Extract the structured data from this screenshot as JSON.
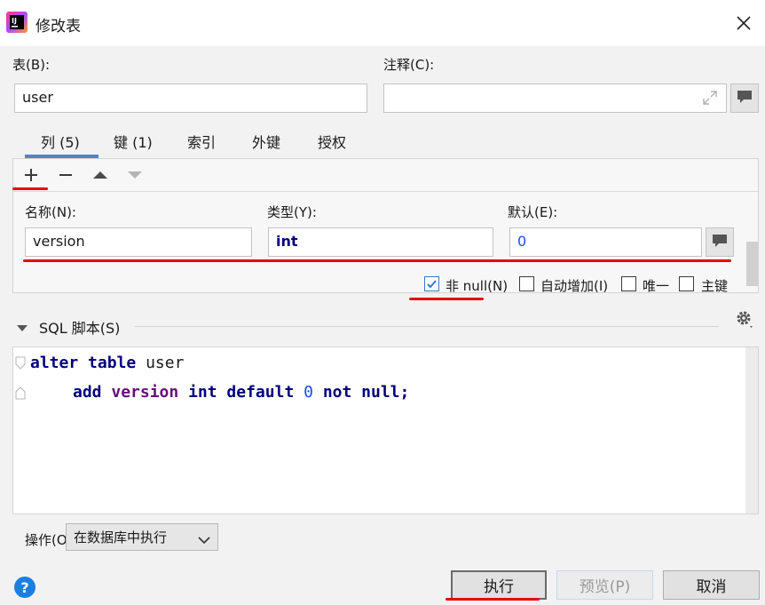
{
  "window": {
    "title": "修改表",
    "app_icon": "intellij-icon"
  },
  "table_field": {
    "label": "表(B):",
    "value": "user"
  },
  "comment_field": {
    "label": "注释(C):",
    "value": ""
  },
  "tabs": [
    {
      "label": "列 (5)",
      "active": true
    },
    {
      "label": "键 (1)",
      "active": false
    },
    {
      "label": "索引",
      "active": false
    },
    {
      "label": "外键",
      "active": false
    },
    {
      "label": "授权",
      "active": false
    }
  ],
  "column_toolbar": {
    "icons": [
      "add-icon",
      "remove-icon",
      "move-up-icon",
      "move-down-icon"
    ]
  },
  "column": {
    "name_label": "名称(N):",
    "name_value": "version",
    "type_label": "类型(Y):",
    "type_value": "int",
    "default_label": "默认(E):",
    "default_value": "0"
  },
  "options": [
    {
      "label": "非 null(N)",
      "checked": true
    },
    {
      "label": "自动增加(I)",
      "checked": false
    },
    {
      "label": "唯一",
      "checked": false
    },
    {
      "label": "主键",
      "checked": false
    }
  ],
  "sql_section": {
    "label": "SQL 脚本(S)"
  },
  "sql": {
    "line1": [
      "alter",
      "table",
      "user"
    ],
    "line2": [
      "add",
      "version",
      "int",
      "default",
      "0",
      "not",
      "null;"
    ]
  },
  "operation": {
    "label": "操作(O):",
    "selected": "在数据库中执行"
  },
  "buttons": {
    "execute": "执行",
    "preview": "预览(P)",
    "cancel": "取消",
    "help": "?"
  },
  "colors": {
    "accent": "#4a86c8",
    "annotation_red": "#e8000b",
    "keyword": "#00007f",
    "identifier": "#660e7a",
    "number": "#1750eb"
  }
}
